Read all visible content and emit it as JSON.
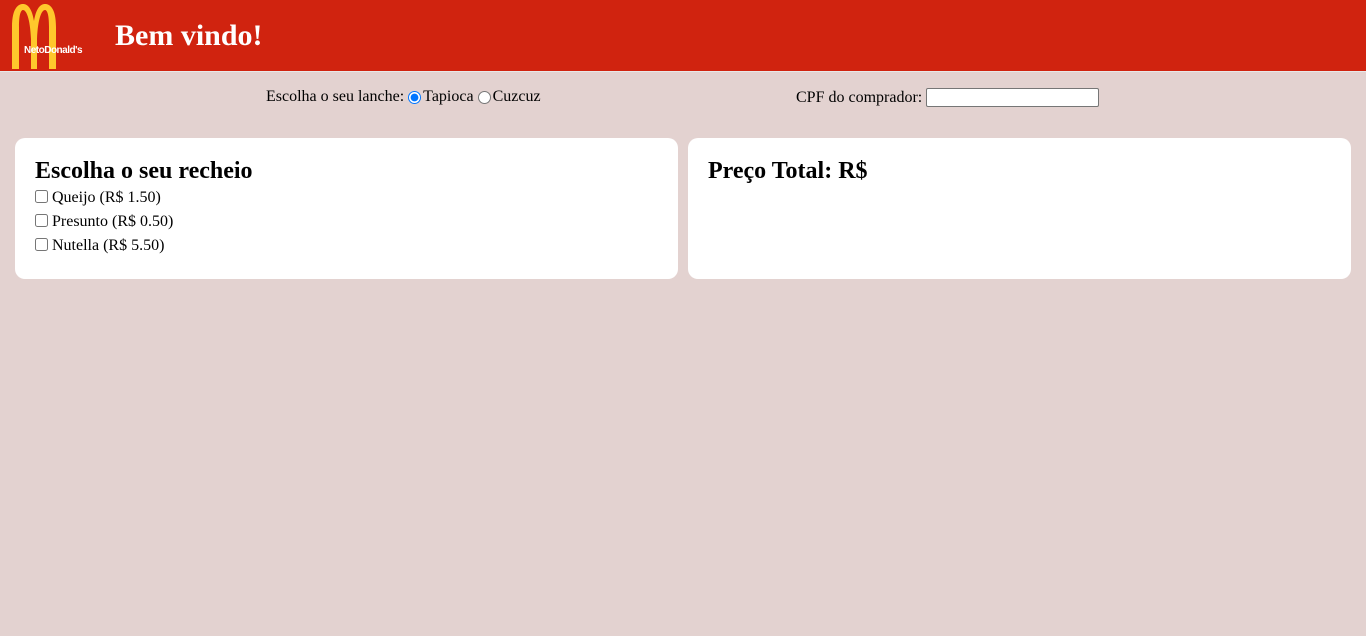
{
  "header": {
    "logo_text": "NetoDonald's",
    "title": "Bem vindo!",
    "colors": {
      "background": "#d0230f",
      "logo_arches": "#ffc72c"
    }
  },
  "order": {
    "lanche_label": "Escolha o seu lanche:",
    "lanche_options": [
      {
        "label": "Tapioca",
        "selected": true
      },
      {
        "label": "Cuzcuz",
        "selected": false
      }
    ],
    "cpf_label": "CPF do comprador:",
    "cpf_value": ""
  },
  "recheio": {
    "title": "Escolha o seu recheio",
    "options": [
      {
        "label": "Queijo (R$ 1.50)",
        "checked": false
      },
      {
        "label": "Presunto (R$ 0.50)",
        "checked": false
      },
      {
        "label": "Nutella (R$ 5.50)",
        "checked": false
      }
    ]
  },
  "total": {
    "title": "Preço Total: R$"
  },
  "page": {
    "background": "#e3d2d0"
  }
}
